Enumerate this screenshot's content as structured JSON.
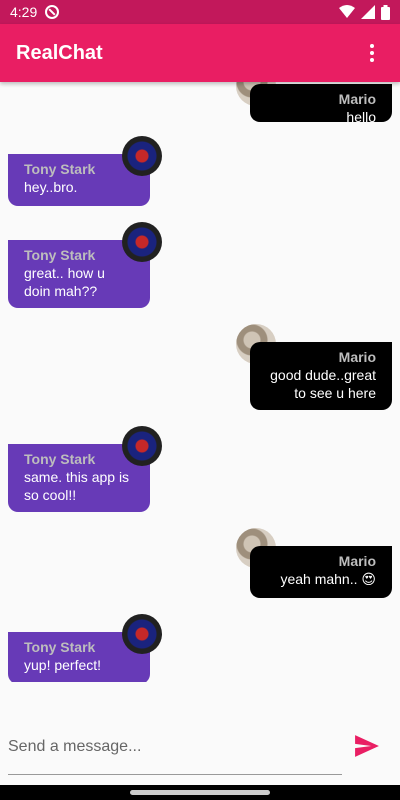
{
  "status_bar": {
    "time": "4:29",
    "left_icon": "no-disturb-icon",
    "icons": [
      "wifi-icon",
      "signal-icon",
      "battery-icon"
    ]
  },
  "app_bar": {
    "title": "RealChat",
    "menu_icon": "more-vert-icon"
  },
  "colors": {
    "status_bar": "#c2185b",
    "app_bar": "#e91e63",
    "incoming_bubble": "#673ab7",
    "outgoing_bubble": "#000000",
    "sender_name": "#bdbdbd",
    "send_icon": "#e91e63"
  },
  "messages": [
    {
      "sender": "Mario",
      "text": "hello",
      "direction": "outgoing",
      "avatar": "mario-avatar"
    },
    {
      "sender": "Tony Stark",
      "text": "hey..bro.",
      "direction": "incoming",
      "avatar": "tony-avatar"
    },
    {
      "sender": "Tony Stark",
      "text": "great.. how u\ndoin mah??",
      "direction": "incoming",
      "avatar": "tony-avatar"
    },
    {
      "sender": "Mario",
      "text": "good dude..great\nto see u here",
      "direction": "outgoing",
      "avatar": "mario-avatar"
    },
    {
      "sender": "Tony Stark",
      "text": "same. this app is\nso cool!!",
      "direction": "incoming",
      "avatar": "tony-avatar"
    },
    {
      "sender": "Mario",
      "text": "yeah mahn.. 😍",
      "direction": "outgoing",
      "avatar": "mario-avatar"
    },
    {
      "sender": "Tony Stark",
      "text": "yup! perfect!",
      "direction": "incoming",
      "avatar": "tony-avatar"
    }
  ],
  "composer": {
    "placeholder": "Send a message...",
    "value": "",
    "send_icon": "send-icon"
  }
}
